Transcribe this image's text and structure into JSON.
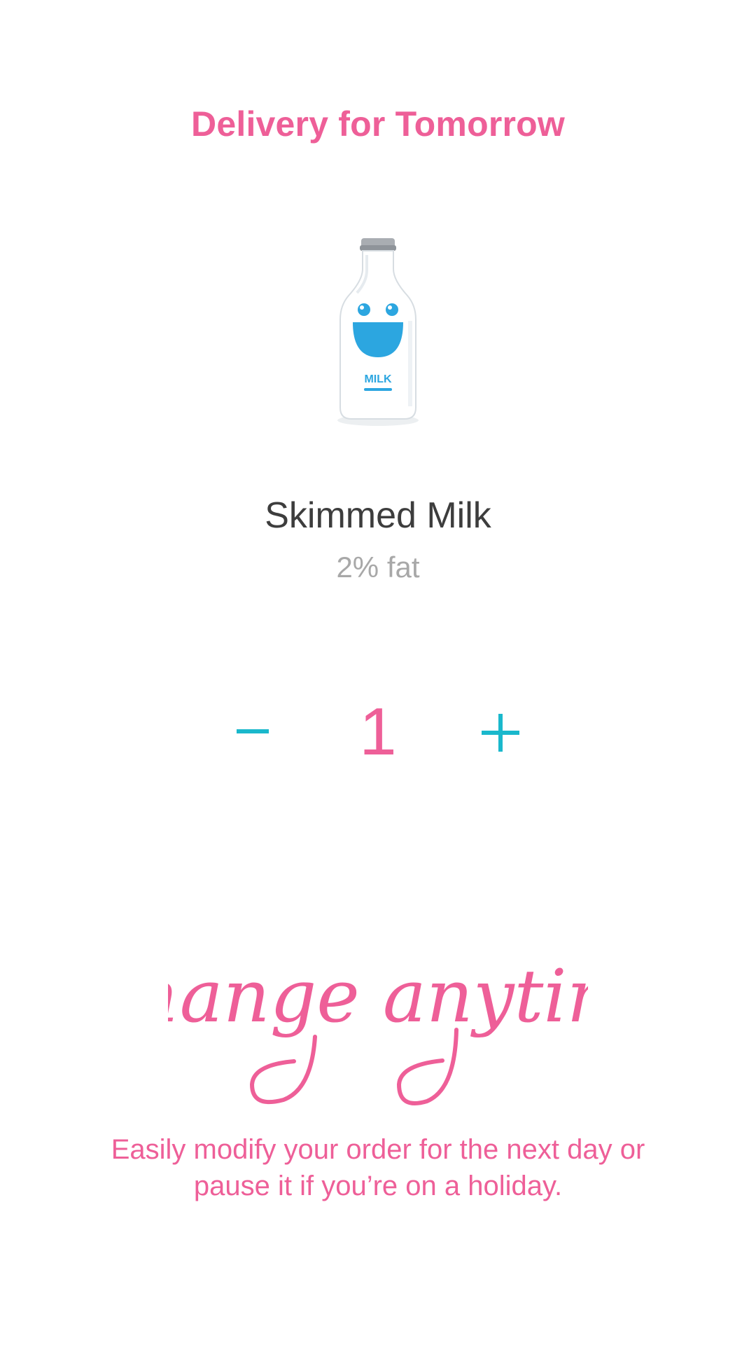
{
  "header": {
    "title": "Delivery for Tomorrow"
  },
  "product": {
    "image_icon": "milk-bottle-icon",
    "bottle_label": "MILK",
    "name": "Skimmed Milk",
    "fat": "2% fat"
  },
  "quantity": {
    "decrement_label": "−",
    "value": "1",
    "increment_label": "+"
  },
  "promo": {
    "title": "Change anytime",
    "description": "Easily modify your order for the next day or pause it if you’re on a holiday."
  },
  "colors": {
    "accent_pink": "#ee5f98",
    "accent_cyan": "#1ab8cc",
    "text_dark": "#3d3d3d",
    "text_muted": "#a8a8a8",
    "bottle_blue": "#2ca6e0"
  }
}
